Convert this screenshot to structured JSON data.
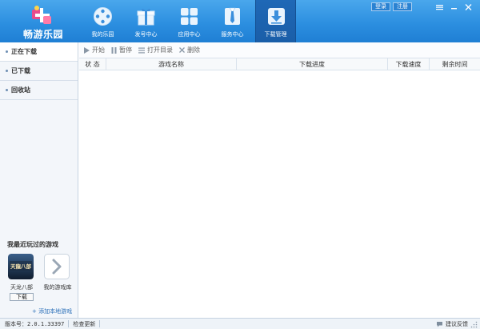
{
  "app": {
    "logo_text": "畅游乐园"
  },
  "nav": {
    "items": [
      {
        "label": "我的乐园",
        "icon": "gamepad-icon"
      },
      {
        "label": "发号中心",
        "icon": "gift-icon"
      },
      {
        "label": "应用中心",
        "icon": "apps-grid-icon"
      },
      {
        "label": "服务中心",
        "icon": "tie-icon"
      },
      {
        "label": "下载管理",
        "icon": "download-icon"
      }
    ],
    "active_index": 4
  },
  "top_links": {
    "login": "登录",
    "register": "注册"
  },
  "sidebar": {
    "items": [
      {
        "label": "正在下载"
      },
      {
        "label": "已下载"
      },
      {
        "label": "回收站"
      }
    ],
    "recent_title": "我最近玩过的游戏",
    "games": [
      {
        "name": "天龙八部",
        "thumb_text": "天龍八部"
      },
      {
        "name": "我的游戏库"
      }
    ],
    "download_button": "下载",
    "add_local": "+ 添加本地游戏"
  },
  "toolbar": {
    "start": "开始",
    "pause": "暂停",
    "open_dir": "打开目录",
    "delete": "删除"
  },
  "table": {
    "columns": [
      "状 态",
      "游戏名称",
      "下载进度",
      "下载速度",
      "剩余时间"
    ],
    "rows": []
  },
  "statusbar": {
    "version": "版本号：2.0.1.33397",
    "check_update": "检查更新",
    "feedback": "建议反馈"
  },
  "colors": {
    "header": "#2c8fe0",
    "active_tab": "#1f68b6",
    "sidebar": "#f3f6fa"
  }
}
